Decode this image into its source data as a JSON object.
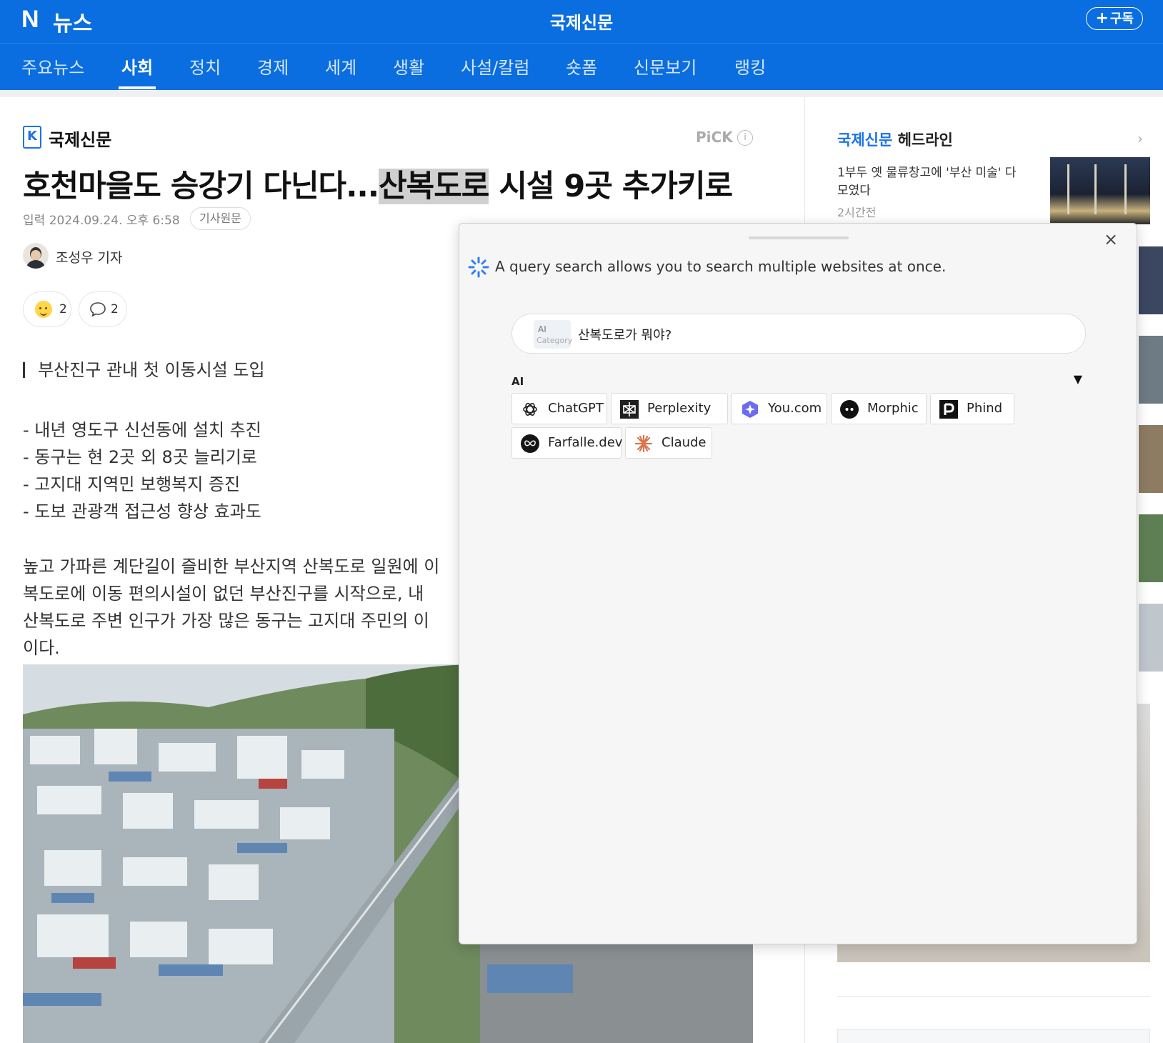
{
  "header": {
    "logo": "N",
    "section": "뉴스",
    "press": "국제신문",
    "subscribe": "구독"
  },
  "nav": {
    "items": [
      "주요뉴스",
      "사회",
      "정치",
      "경제",
      "세계",
      "생활",
      "사설/칼럼",
      "숏폼",
      "신문보기",
      "랭킹"
    ],
    "active": "사회"
  },
  "article": {
    "press_name": "국제신문",
    "pick_label": "PiCK",
    "headline_before": "호천마을도 승강기 다닌다...",
    "headline_highlight": "산복도로",
    "headline_after": " 시설 9곳 추가키로",
    "date_label": "입력",
    "date": "2024.09.24. 오후 6:58",
    "original_button": "기사원문",
    "reporter": "조성우 기자",
    "reaction_count": "2",
    "comment_count": "2",
    "subhead": "부산진구 관내 첫 이동시설 도입",
    "bullets": [
      "- 내년 영도구 신선동에 설치 추진",
      "- 동구는 현 2곳 외 8곳 늘리기로",
      "- 고지대 지역민 보행복지 증진",
      "- 도보 관광객 접근성 향상 효과도"
    ],
    "body_lines": [
      "높고 가파른 계단길이 즐비한 부산지역 산복도로 일원에 이",
      "복도로에 이동 편의시설이 없던 부산진구를 시작으로, 내",
      "산복도로 주변 인구가 가장 많은 동구는 고지대 주민의 이",
      "이다."
    ]
  },
  "sidebar": {
    "title_press": "국제신문",
    "title_suffix": " 헤드라인",
    "item_title": "1부두 옛 물류창고에 '부산 미술' 다 모였다",
    "item_time": "2시간전"
  },
  "panel": {
    "message": "A query search allows you to search multiple websites at once.",
    "category_ai": "AI",
    "category_label": "Category",
    "query": "산복도로가 뭐야?",
    "group_label": "AI",
    "toggle": "▼",
    "close": "×",
    "engines": [
      "ChatGPT",
      "Perplexity AI",
      "You.com",
      "Morphic",
      "Phind",
      "Farfalle.dev",
      "Claude"
    ]
  }
}
